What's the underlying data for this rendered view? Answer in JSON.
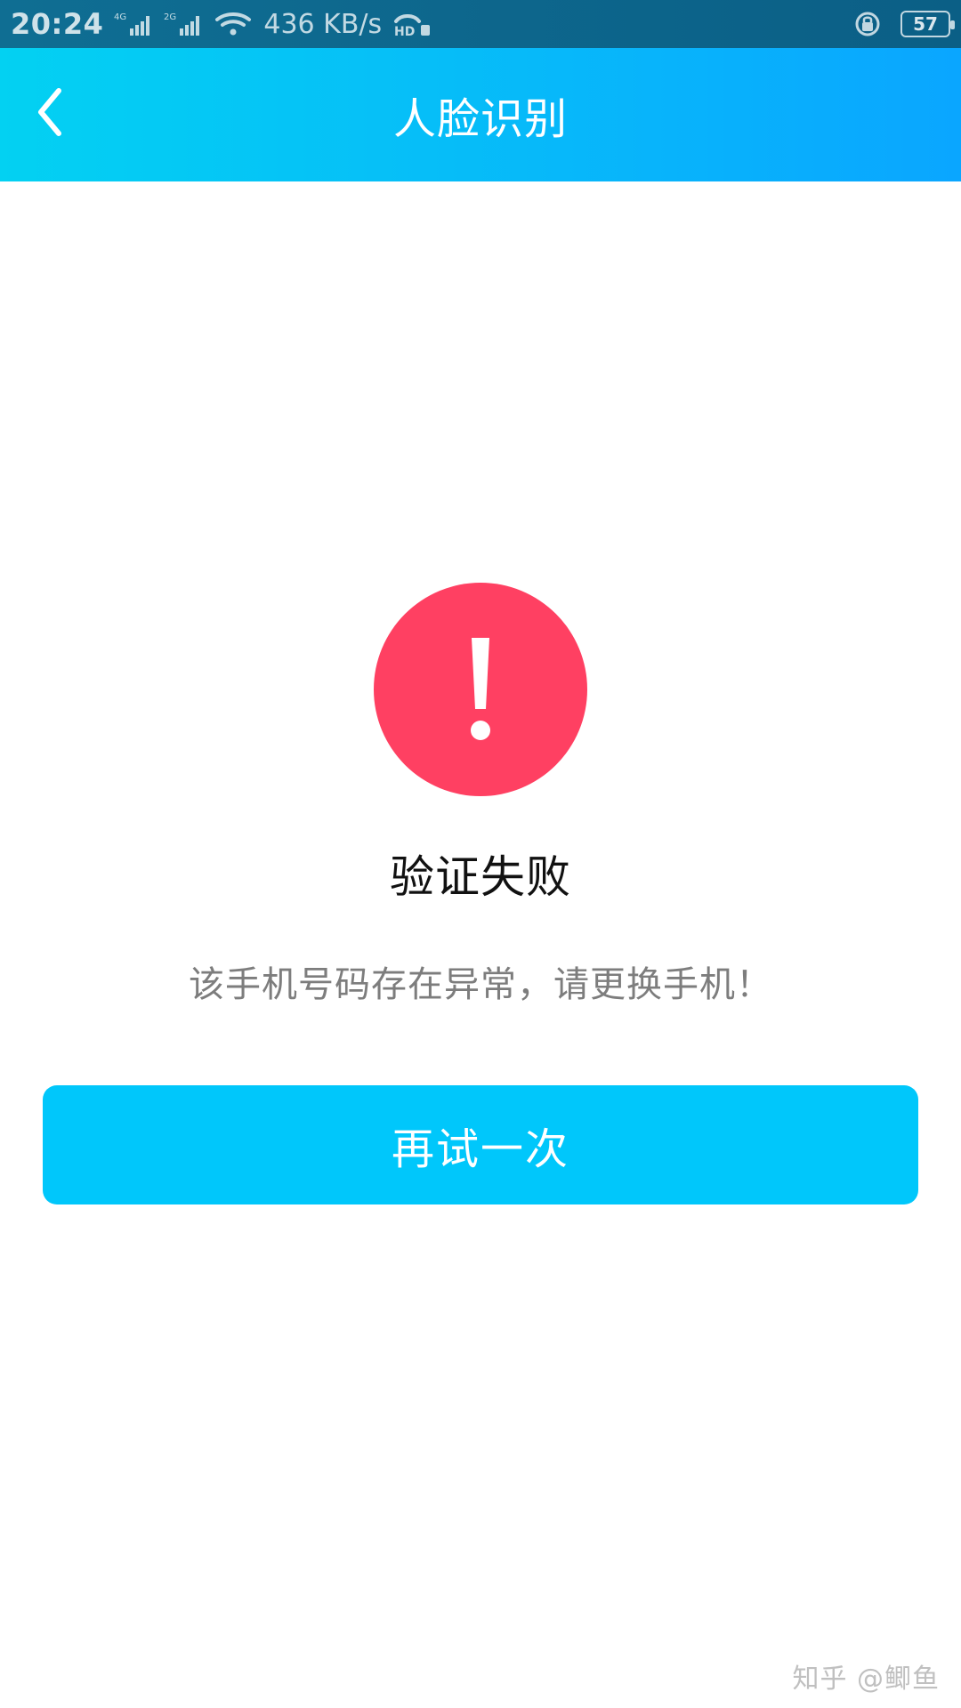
{
  "status_bar": {
    "time": "20:24",
    "network_1": "4G",
    "network_2": "2G",
    "speed": "436 KB/s",
    "hd_label": "HD",
    "battery": "57",
    "icons": [
      "signal-4g-icon",
      "signal-2g-icon",
      "wifi-icon",
      "hd-call-icon",
      "lock-rotation-icon",
      "battery-icon"
    ]
  },
  "header": {
    "title": "人脸识别",
    "back_icon": "back-chevron-icon"
  },
  "main": {
    "icon": "exclamation-alert-icon",
    "title": "验证失败",
    "message": "该手机号码存在异常，请更换手机！",
    "retry_label": "再试一次"
  },
  "watermark": "知乎 @鲫鱼",
  "colors": {
    "status_bar": "#0f6e93",
    "header_start": "#03d1f2",
    "header_end": "#0aa6ff",
    "alert_red": "#ff4062",
    "button_blue": "#00c7fb",
    "message_gray": "#7d7d7d"
  }
}
